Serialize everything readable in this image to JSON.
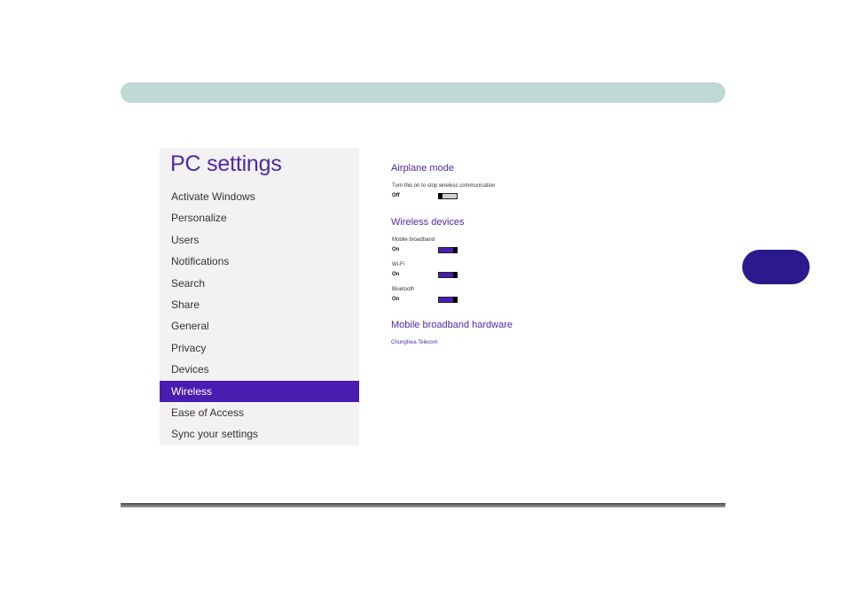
{
  "pc_settings": {
    "title": "PC settings",
    "nav_items": [
      {
        "label": "Activate Windows"
      },
      {
        "label": "Personalize"
      },
      {
        "label": "Users"
      },
      {
        "label": "Notifications"
      },
      {
        "label": "Search"
      },
      {
        "label": "Share"
      },
      {
        "label": "General"
      },
      {
        "label": "Privacy"
      },
      {
        "label": "Devices"
      },
      {
        "label": "Wireless",
        "selected": true
      },
      {
        "label": "Ease of Access"
      },
      {
        "label": "Sync your settings"
      }
    ]
  },
  "wireless_panel": {
    "airplane_mode": {
      "heading": "Airplane mode",
      "description": "Turn this on to stop wireless communication",
      "state": "Off"
    },
    "wireless_devices": {
      "heading": "Wireless devices",
      "devices": [
        {
          "name": "Mobile broadband",
          "state": "On"
        },
        {
          "name": "Wi-Fi",
          "state": "On"
        },
        {
          "name": "Bluetooth",
          "state": "On"
        }
      ]
    },
    "mobile_broadband_hardware": {
      "heading": "Mobile broadband hardware",
      "provider": "Chunghwa Telecom"
    }
  },
  "colors": {
    "accent": "#4b1cb0",
    "header_bar": "#c0d9d6",
    "chapter_tab": "#2a1a8c"
  }
}
